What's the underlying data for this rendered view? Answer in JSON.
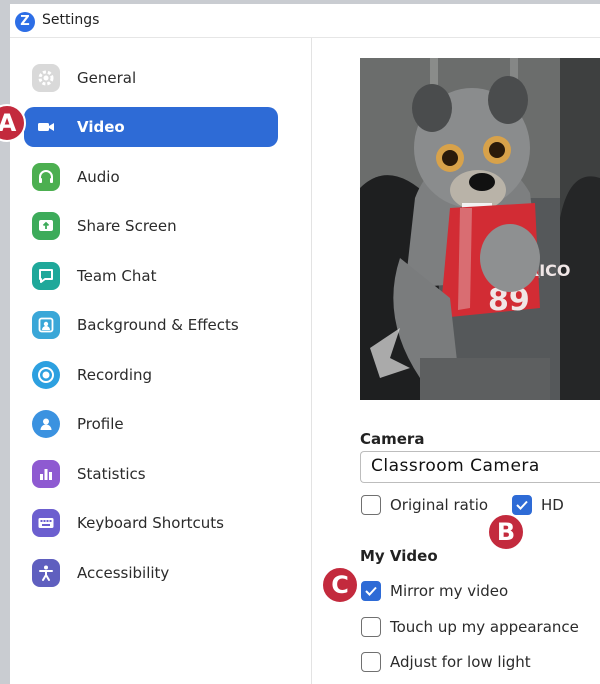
{
  "window": {
    "title": "Settings",
    "logo_letter": "Z"
  },
  "sidebar": {
    "items": [
      {
        "label": "General",
        "icon": "gear-icon",
        "color": "#d9d9d9"
      },
      {
        "label": "Video",
        "icon": "video-camera-icon",
        "color": "#2e6bd6",
        "active": true
      },
      {
        "label": "Audio",
        "icon": "headphones-icon",
        "color": "#4caf50"
      },
      {
        "label": "Share Screen",
        "icon": "share-screen-icon",
        "color": "#3dab5a"
      },
      {
        "label": "Team Chat",
        "icon": "chat-bubble-icon",
        "color": "#1fa89a"
      },
      {
        "label": "Background & Effects",
        "icon": "portrait-icon",
        "color": "#3aa7d8"
      },
      {
        "label": "Recording",
        "icon": "record-icon",
        "color": "#2da0e0"
      },
      {
        "label": "Profile",
        "icon": "person-icon",
        "color": "#3b92e0"
      },
      {
        "label": "Statistics",
        "icon": "bar-chart-icon",
        "color": "#8e5ad1"
      },
      {
        "label": "Keyboard Shortcuts",
        "icon": "keyboard-icon",
        "color": "#6c5fcf"
      },
      {
        "label": "Accessibility",
        "icon": "accessibility-icon",
        "color": "#5f5fbf"
      }
    ]
  },
  "camera": {
    "section_title": "Camera",
    "selected_camera": "Classroom Camera",
    "original_ratio": {
      "label": "Original ratio",
      "checked": false
    },
    "hd": {
      "label": "HD",
      "checked": true
    }
  },
  "my_video": {
    "section_title": "My Video",
    "mirror": {
      "label": "Mirror my video",
      "checked": true
    },
    "touch_up": {
      "label": "Touch up my appearance",
      "checked": false
    },
    "low_light": {
      "label": "Adjust for low light",
      "checked": false
    }
  },
  "preview": {
    "jersey_text": "MEXICO",
    "jersey_number": "89"
  },
  "callouts": {
    "a": "A",
    "b": "B",
    "c": "C"
  },
  "colors": {
    "accent": "#2e6bd6",
    "callout": "#c32a3d"
  }
}
